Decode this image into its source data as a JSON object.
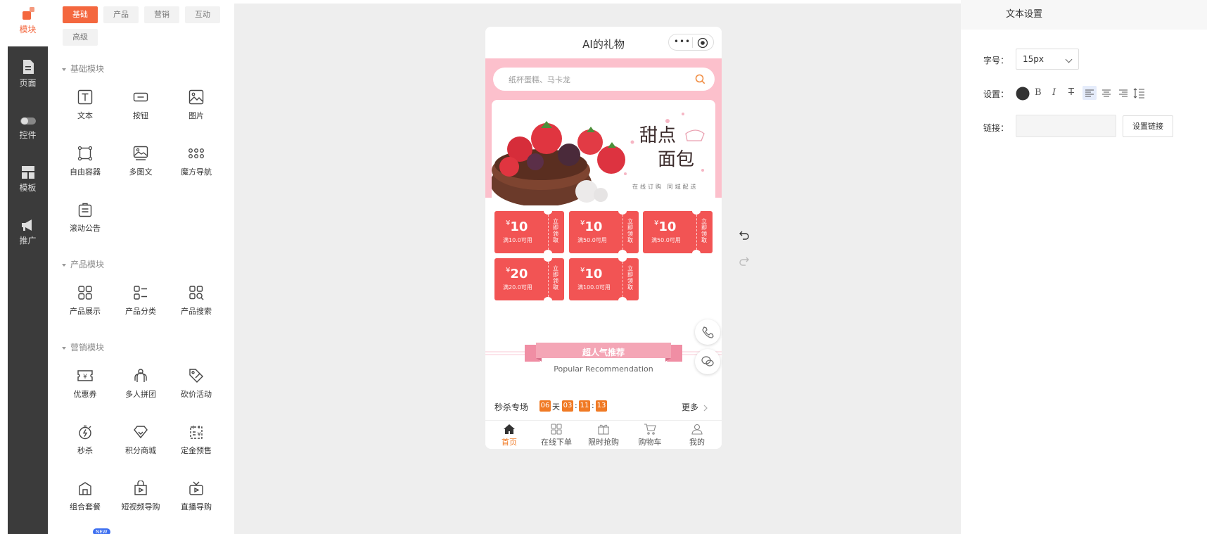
{
  "rail": {
    "items": [
      {
        "label": "模块",
        "icon": "module-icon",
        "active": true
      },
      {
        "label": "页面",
        "icon": "page-icon"
      },
      {
        "label": "控件",
        "icon": "toggle-icon"
      },
      {
        "label": "模板",
        "icon": "template-icon"
      },
      {
        "label": "推广",
        "icon": "megaphone-icon"
      }
    ]
  },
  "modpanel": {
    "tabs": [
      "基础",
      "产品",
      "营销",
      "互动",
      "高级"
    ],
    "active_tab": "基础",
    "sections": [
      {
        "title": "基础模块",
        "items": [
          "文本",
          "按钮",
          "图片",
          "自由容器",
          "多图文",
          "魔方导航",
          "滚动公告"
        ]
      },
      {
        "title": "产品模块",
        "items": [
          "产品展示",
          "产品分类",
          "产品搜索"
        ]
      },
      {
        "title": "营销模块",
        "items": [
          "优惠券",
          "多人拼团",
          "砍价活动",
          "秒杀",
          "积分商城",
          "定金预售",
          "组合套餐",
          "短视频导购",
          "直播导购"
        ]
      }
    ],
    "new_badge": "NEW"
  },
  "phone": {
    "title": "AI的礼物",
    "capsule_dots": "•••",
    "search_placeholder": "纸杯蛋糕、马卡龙",
    "banner": {
      "line1": "甜点",
      "line2": "面包",
      "sub": "在线订购 同城配送"
    },
    "coupons": [
      {
        "currency": "¥",
        "amount": "10",
        "condition": "满10.0可用",
        "action": "立即领取"
      },
      {
        "currency": "¥",
        "amount": "10",
        "condition": "满50.0可用",
        "action": "立即领取"
      },
      {
        "currency": "¥",
        "amount": "10",
        "condition": "满50.0可用",
        "action": "立即领取"
      },
      {
        "currency": "¥",
        "amount": "20",
        "condition": "满20.0可用",
        "action": "立即领取"
      },
      {
        "currency": "¥",
        "amount": "10",
        "condition": "满100.0可用",
        "action": "立即领取"
      }
    ],
    "recommend": {
      "title": "超人气推荐",
      "subtitle": "Popular Recommendation"
    },
    "seckill": {
      "label": "秒杀专场",
      "days": "06",
      "day_unit": "天",
      "hours": "03",
      "sep": ":",
      "minutes": "11",
      "seconds": "13",
      "more": "更多"
    },
    "tabbar": [
      {
        "label": "首页",
        "icon": "home-icon",
        "active": true
      },
      {
        "label": "在线下单",
        "icon": "grid-icon"
      },
      {
        "label": "限时抢购",
        "icon": "gift-icon"
      },
      {
        "label": "购物车",
        "icon": "cart-icon"
      },
      {
        "label": "我的",
        "icon": "user-icon"
      }
    ]
  },
  "settings": {
    "title": "文本设置",
    "font_size_label": "字号：",
    "font_size_value": "15px",
    "style_label": "设置：",
    "text_color": "#333333",
    "bold": "B",
    "italic": "I",
    "strike": "T",
    "link_label": "链接：",
    "link_button": "设置链接"
  },
  "colors": {
    "accent": "#f4673e",
    "rail_bg": "#3b3b3b",
    "coupon": "#f25454",
    "countdown": "#f07a25"
  }
}
